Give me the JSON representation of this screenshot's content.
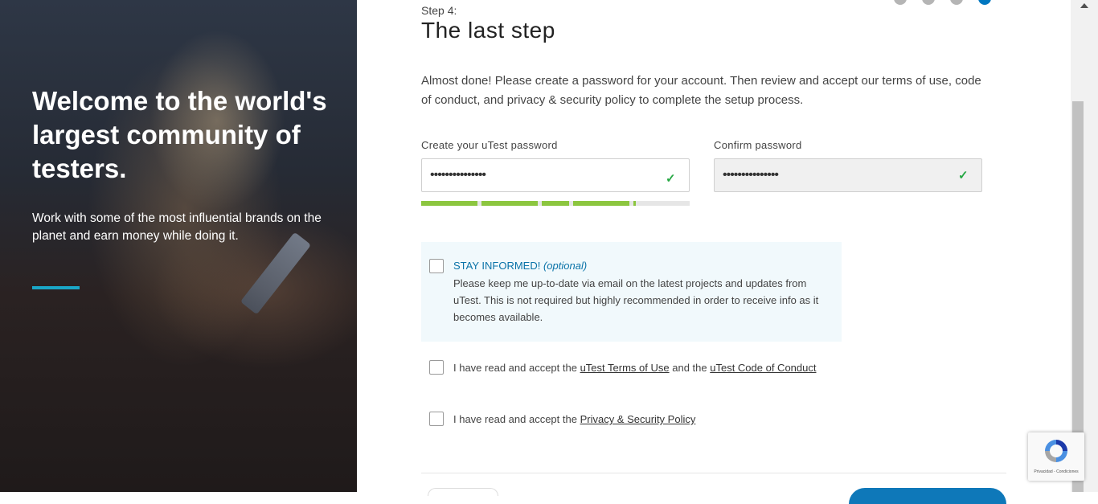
{
  "hero": {
    "title": "Welcome to the world's largest community of testers.",
    "subtitle": "Work with some of the most influential brands on the planet and earn money while doing it.",
    "accent_color": "#1aa6c7"
  },
  "form": {
    "step_label": "Step 4:",
    "step_title": "The last step",
    "intro": "Almost done! Please create a password for your account. Then review and accept our terms of use, code of conduct, and privacy & security policy to complete the setup process.",
    "password_label": "Create your uTest password",
    "password_value": "•••••••••••••••",
    "confirm_label": "Confirm password",
    "confirm_value": "•••••••••••••••",
    "check_icon": "✓",
    "strength_level": 0.8,
    "stay_informed_title": "STAY INFORMED!",
    "stay_informed_optional": "(optional)",
    "stay_informed_text": "Please keep me up-to-date via email on the latest projects and updates from uTest. This is not required but highly recommended in order to receive info as it becomes available.",
    "terms_prefix": "I have read and accept the",
    "terms_link": "uTest Terms of Use",
    "terms_and": "and the",
    "conduct_link": "uTest Code of Conduct",
    "privacy_prefix": "I have read and accept the",
    "privacy_link": "Privacy & Security Policy"
  },
  "recaptcha": {
    "text": "Privacidad - Condiciones"
  },
  "colors": {
    "brand_blue": "#0e78b9",
    "success_green": "#27a844",
    "strength_green": "#8cc63f"
  }
}
